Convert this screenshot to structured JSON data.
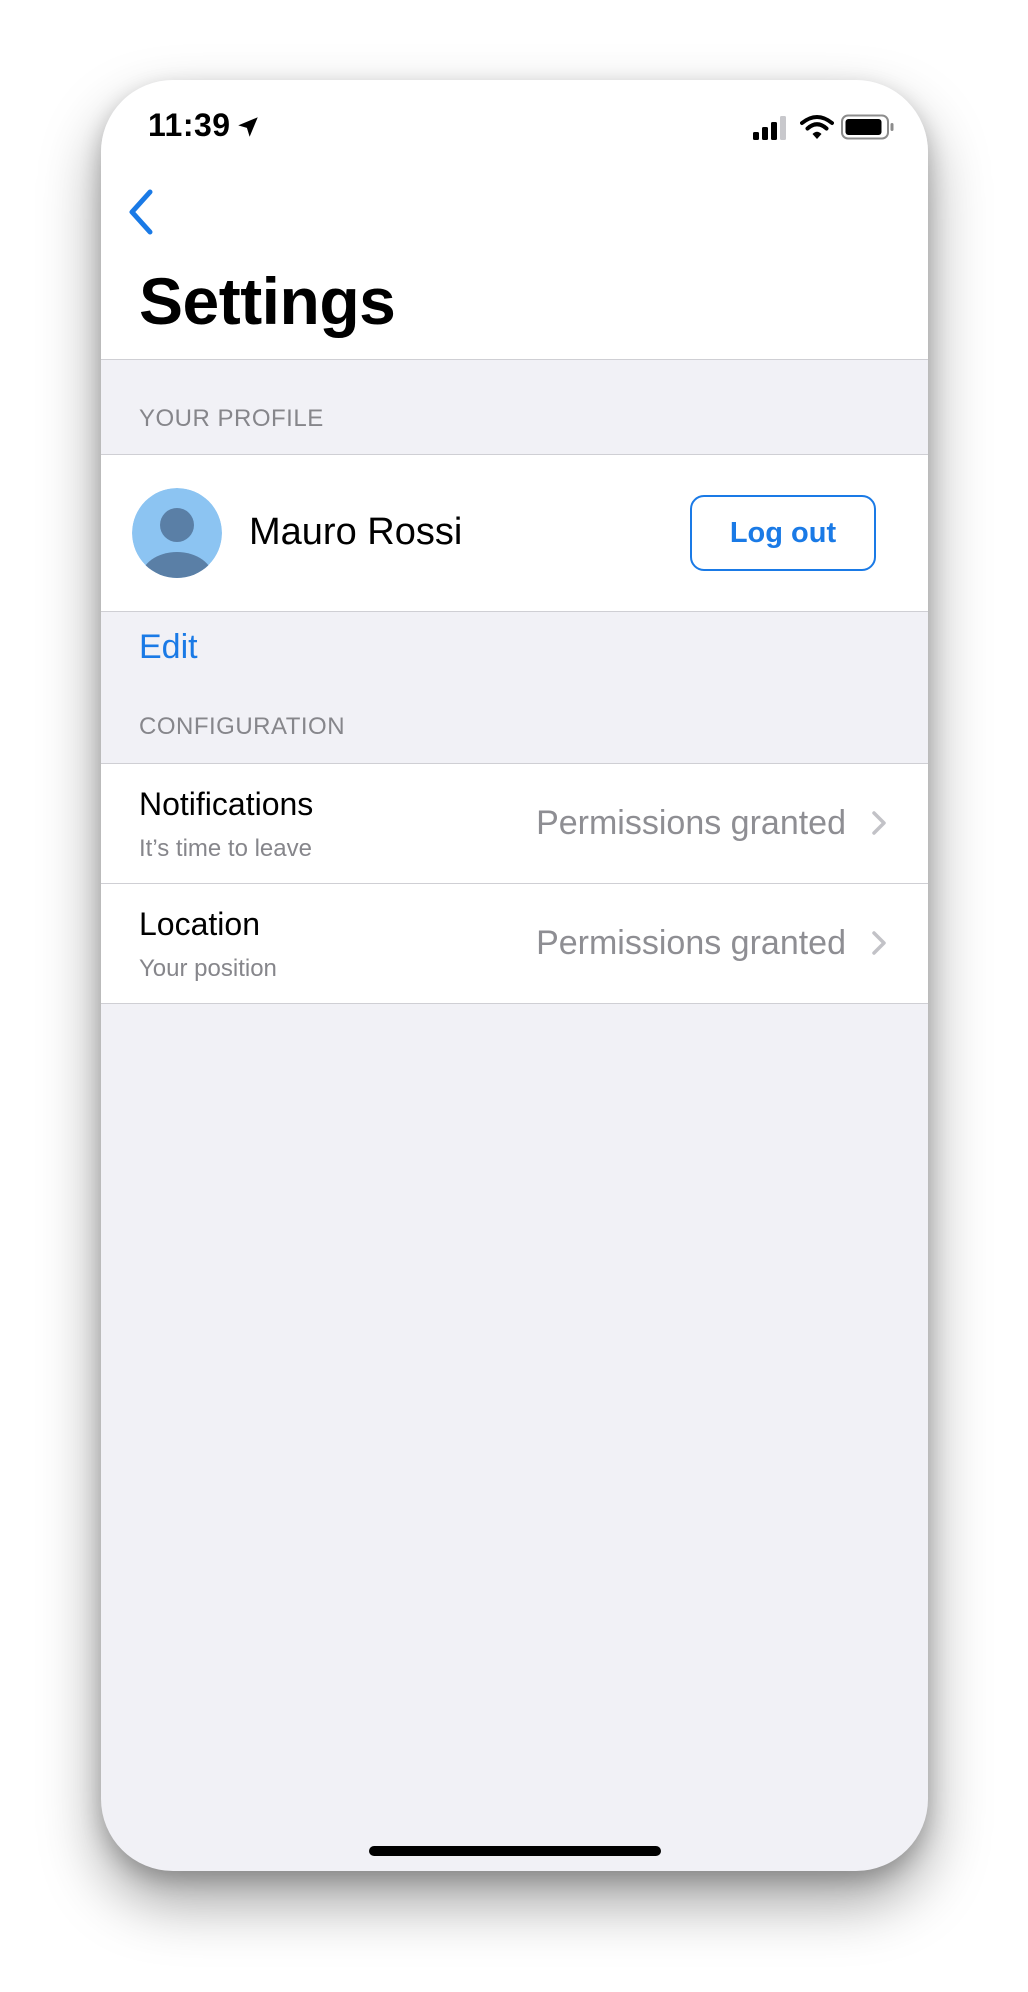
{
  "status_bar": {
    "time": "11:39",
    "location_icon": "location-arrow-icon",
    "signal_icon": "cellular-signal-icon",
    "wifi_icon": "wifi-icon",
    "battery_icon": "battery-icon"
  },
  "nav": {
    "back_icon": "chevron-left-icon",
    "title": "Settings"
  },
  "profile_section": {
    "header": "YOUR PROFILE",
    "name": "Mauro Rossi",
    "avatar_icon": "person-avatar-icon",
    "logout_label": "Log out",
    "edit_label": "Edit"
  },
  "configuration_section": {
    "header": "CONFIGURATION",
    "rows": [
      {
        "title": "Notifications",
        "subtitle": "It’s time to leave",
        "value": "Permissions granted",
        "icon": "chevron-right-icon"
      },
      {
        "title": "Location",
        "subtitle": "Your position",
        "value": "Permissions granted",
        "icon": "chevron-right-icon"
      }
    ]
  },
  "colors": {
    "accent": "#1a7ae6",
    "background": "#f1f1f6",
    "secondary_text": "#86868b",
    "avatar_bg": "#8cc4f2",
    "avatar_figure": "#5a7fa6"
  }
}
